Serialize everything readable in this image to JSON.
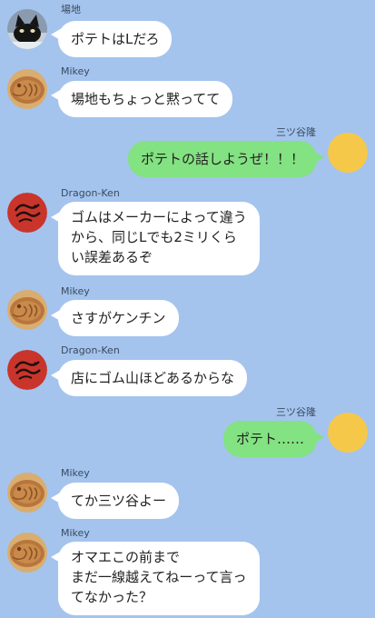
{
  "colors": {
    "background": "#a4c4ee",
    "incoming_bubble": "#ffffff",
    "outgoing_bubble": "#83e281",
    "outgoing_avatar": "#f6c84a"
  },
  "messages": [
    {
      "sender": "場地",
      "side": "left",
      "avatar": "black-cat-avatar",
      "text": "ポテトはLだろ"
    },
    {
      "sender": "Mikey",
      "side": "left",
      "avatar": "taiyaki-avatar",
      "text": "場地もちょっと黙ってて"
    },
    {
      "sender": "三ツ谷隆",
      "side": "right",
      "avatar": "yellow-circle-avatar",
      "text": "ポテトの話しようぜ！！！"
    },
    {
      "sender": "Dragon-Ken",
      "side": "left",
      "avatar": "red-dragon-avatar",
      "text": "ゴムはメーカーによって違う\nから、同じLでも2ミリくら\nい誤差あるぞ"
    },
    {
      "sender": "Mikey",
      "side": "left",
      "avatar": "taiyaki-avatar",
      "text": "さすがケンチン"
    },
    {
      "sender": "Dragon-Ken",
      "side": "left",
      "avatar": "red-dragon-avatar",
      "text": "店にゴム山ほどあるからな"
    },
    {
      "sender": "三ツ谷隆",
      "side": "right",
      "avatar": "yellow-circle-avatar",
      "text": "ポテト……"
    },
    {
      "sender": "Mikey",
      "side": "left",
      "avatar": "taiyaki-avatar",
      "text": "てか三ツ谷よー"
    },
    {
      "sender": "Mikey",
      "side": "left",
      "avatar": "taiyaki-avatar",
      "text": "オマエこの前まで\nまだ一線越えてねーって言っ\nてなかった？"
    }
  ]
}
